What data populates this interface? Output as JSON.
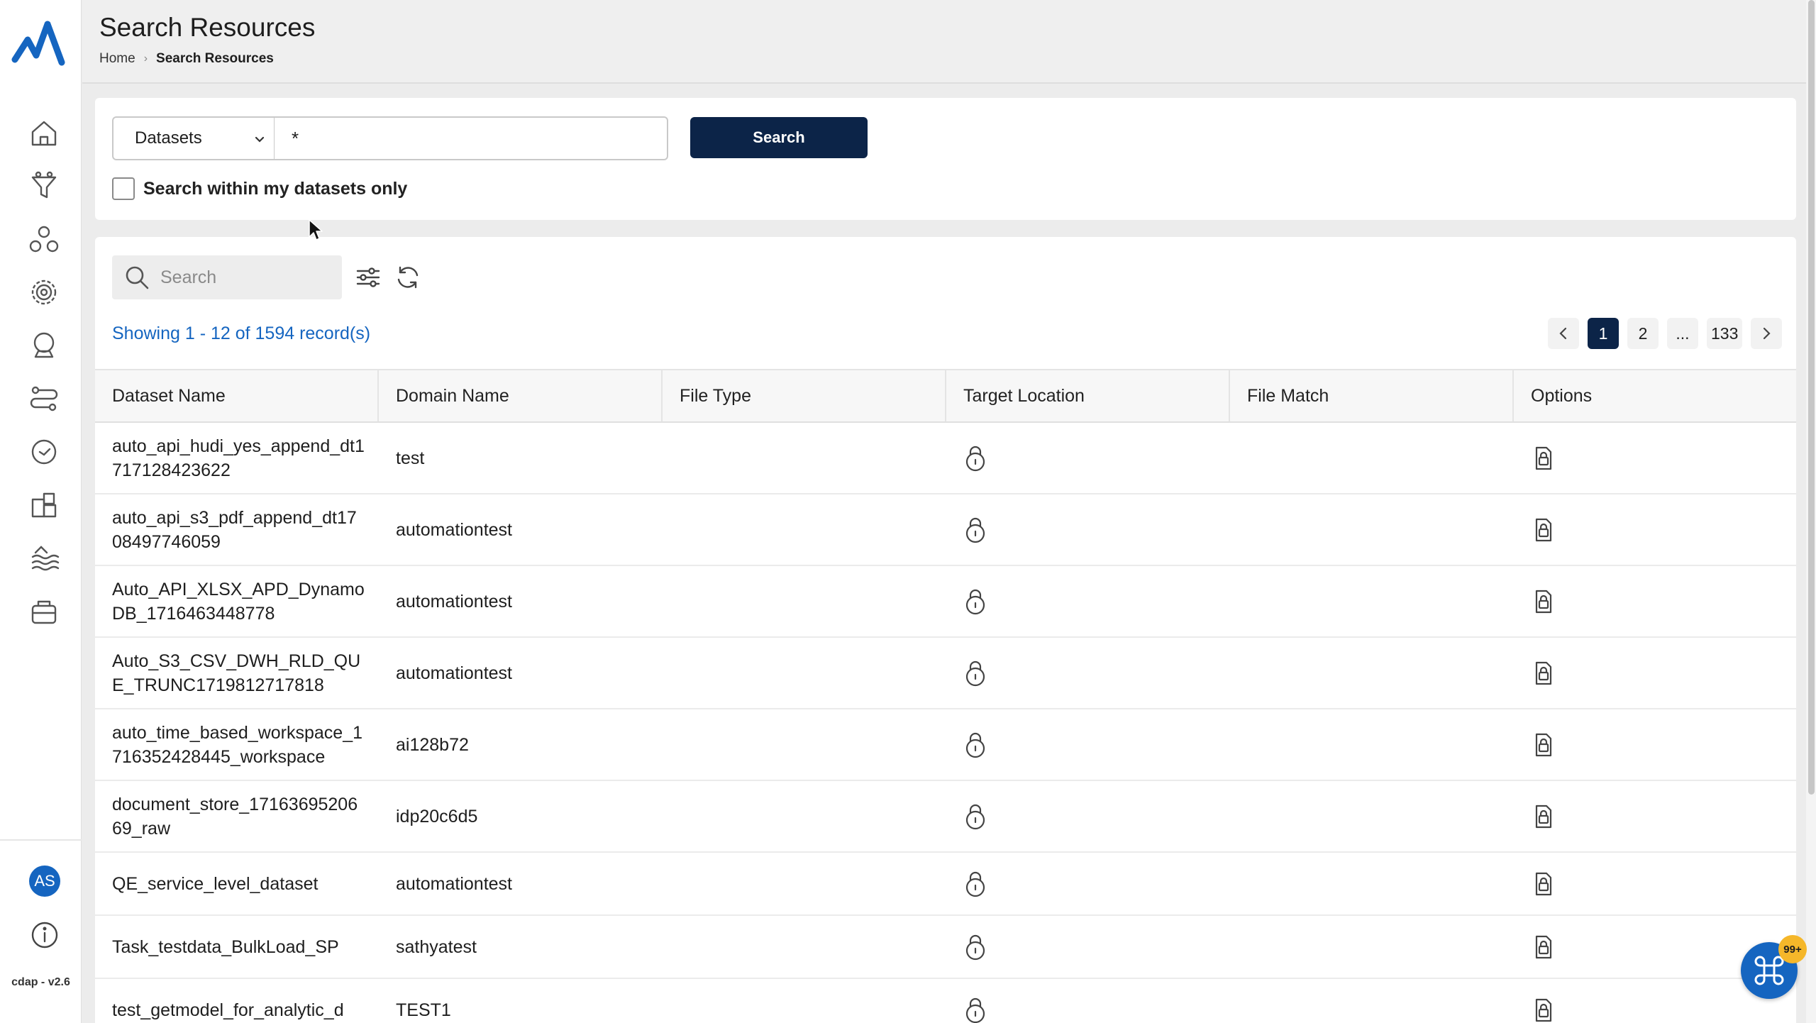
{
  "app": {
    "title": "Search Resources",
    "version": "cdap - v2.6",
    "brand_color": "#1565c0",
    "primary_dark": "#0c2448"
  },
  "breadcrumb": {
    "home": "Home",
    "current": "Search Resources"
  },
  "sidebar": {
    "items": [
      {
        "icon": "home-icon"
      },
      {
        "icon": "funnel-icon"
      },
      {
        "icon": "network-icon"
      },
      {
        "icon": "gear-target-icon"
      },
      {
        "icon": "crystal-ball-icon"
      },
      {
        "icon": "pipeline-icon"
      },
      {
        "icon": "clock-icon"
      },
      {
        "icon": "puzzle-icon"
      },
      {
        "icon": "data-lake-icon"
      },
      {
        "icon": "storage-icon"
      }
    ],
    "avatar": "AS",
    "info_icon": "info-icon"
  },
  "search": {
    "type_value": "Datasets",
    "query_value": "*",
    "button_label": "Search",
    "my_datasets_label": "Search within my datasets only",
    "my_datasets_checked": false
  },
  "results": {
    "filter_placeholder": "Search",
    "showing_text": "Showing 1 - 12 of 1594 record(s)",
    "pagination": {
      "pages": [
        "1",
        "2",
        "...",
        "133"
      ],
      "current": "1"
    },
    "columns": [
      "Dataset Name",
      "Domain Name",
      "File Type",
      "Target Location",
      "File Match",
      "Options"
    ],
    "rows": [
      {
        "dataset": "auto_api_hudi_yes_append_dt1717128423622",
        "domain": "test",
        "file_type": "",
        "file_match": ""
      },
      {
        "dataset": "auto_api_s3_pdf_append_dt1708497746059",
        "domain": "automationtest",
        "file_type": "",
        "file_match": ""
      },
      {
        "dataset": "Auto_API_XLSX_APD_DynamoDB_1716463448778",
        "domain": "automationtest",
        "file_type": "",
        "file_match": ""
      },
      {
        "dataset": "Auto_S3_CSV_DWH_RLD_QUE_TRUNC1719812717818",
        "domain": "automationtest",
        "file_type": "",
        "file_match": ""
      },
      {
        "dataset": "auto_time_based_workspace_1716352428445_workspace",
        "domain": "ai128b72",
        "file_type": "",
        "file_match": ""
      },
      {
        "dataset": "document_store_1716369520669_raw",
        "domain": "idp20c6d5",
        "file_type": "",
        "file_match": ""
      },
      {
        "dataset": "QE_service_level_dataset",
        "domain": "automationtest",
        "file_type": "",
        "file_match": ""
      },
      {
        "dataset": "Task_testdata_BulkLoad_SP",
        "domain": "sathyatest",
        "file_type": "",
        "file_match": ""
      },
      {
        "dataset": "test_getmodel_for_analytic_d",
        "domain": "TEST1",
        "file_type": "",
        "file_match": ""
      }
    ]
  },
  "fab": {
    "icon": "command-icon",
    "badge": "99+"
  }
}
